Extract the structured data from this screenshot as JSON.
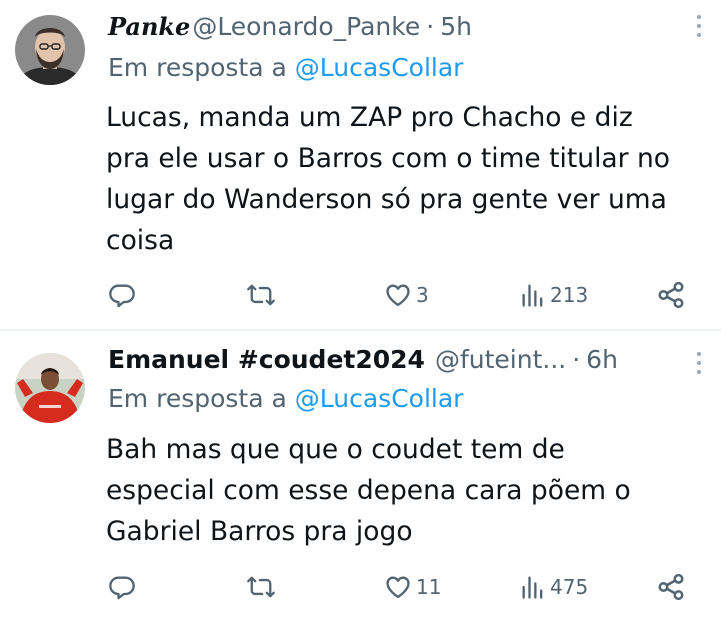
{
  "tweets": [
    {
      "display_name": "Panke",
      "handle": "@Leonardo_Panke",
      "separator": "·",
      "time": "5h",
      "reply_prefix": "Em resposta a",
      "reply_to": "@LucasCollar",
      "lines": [
        "Lucas, manda um ZAP pro Chacho e diz",
        "pra ele usar o Barros com o time titular no",
        "lugar do Wanderson só pra gente ver uma",
        "coisa"
      ],
      "actions": {
        "replies": "",
        "retweets": "",
        "likes": "3",
        "views": "213"
      },
      "icons": {
        "reply": "reply-icon",
        "retweet": "retweet-icon",
        "like": "heart-icon",
        "views": "views-icon",
        "share": "share-icon",
        "more": "more-icon"
      }
    },
    {
      "display_name": "Emanuel #coudet2024",
      "handle": "@futeint...",
      "separator": "·",
      "time": "6h",
      "reply_prefix": "Em resposta a",
      "reply_to": "@LucasCollar",
      "lines": [
        "Bah mas que que o coudet tem de",
        "especial com esse depena cara põem o",
        "Gabriel Barros pra jogo"
      ],
      "actions": {
        "replies": "",
        "retweets": "",
        "likes": "11",
        "views": "475"
      },
      "icons": {
        "reply": "reply-icon",
        "retweet": "retweet-icon",
        "like": "heart-icon",
        "views": "views-icon",
        "share": "share-icon",
        "more": "more-icon"
      }
    }
  ],
  "colors": {
    "text": "#0f1419",
    "secondary": "#536471",
    "accent": "#1d9bf0",
    "divider": "#eff3f4",
    "jersey_red": "#d62b1f"
  }
}
